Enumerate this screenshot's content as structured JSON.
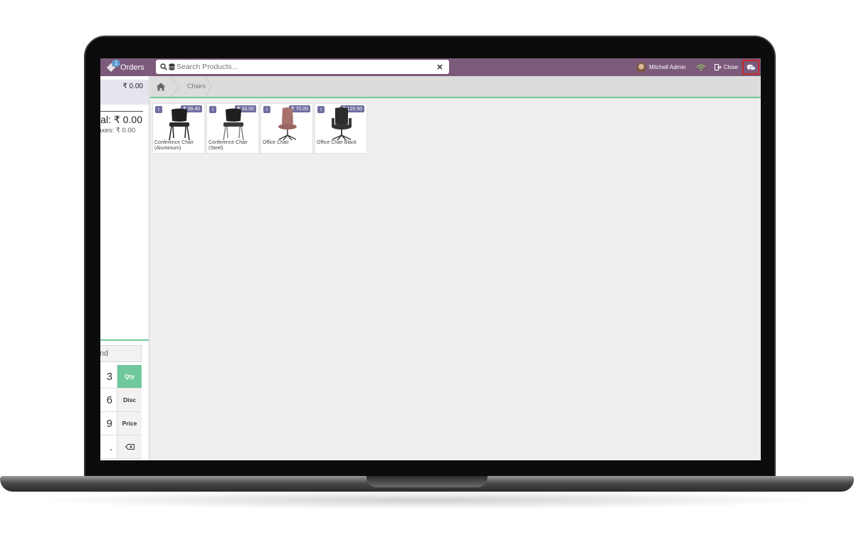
{
  "topbar": {
    "orders_label": "Orders",
    "orders_count": "1",
    "search_placeholder": "Search Products...",
    "user_name": "Mitchell Admin",
    "close_label": "Close",
    "brand_color": "#7c5a7b"
  },
  "left_panel": {
    "line_price": "₹ 0.00",
    "total": "tal: ₹ 0.00",
    "taxes": "axes: ₹ 0.00",
    "customer_fragment": "nd",
    "numpad": [
      {
        "key": "3",
        "fn": "Qty",
        "active": true
      },
      {
        "key": "6",
        "fn": "Disc",
        "active": false
      },
      {
        "key": "9",
        "fn": "Price",
        "active": false
      },
      {
        "key": ".",
        "fn": "⌫",
        "active": false
      }
    ],
    "accent_color": "#6ec89b"
  },
  "breadcrumb": {
    "category": "Chairs"
  },
  "products": [
    {
      "name": "Conference Chair (Aluminium)",
      "price": "₹ 39.40",
      "image": "black-conference-chair"
    },
    {
      "name": "Conference Chair (Steel)",
      "price": "₹ 33.00",
      "image": "black-conference-chair"
    },
    {
      "name": "Office Chair",
      "price": "₹ 70.00",
      "image": "pink-office-chair"
    },
    {
      "name": "Office Chair Black",
      "price": "₹ 120.50",
      "image": "black-office-chair"
    }
  ],
  "price_badge_color": "#6f6fa0"
}
